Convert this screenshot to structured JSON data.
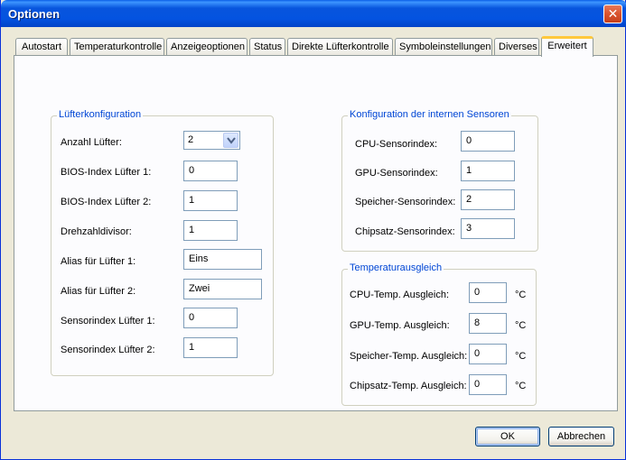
{
  "window": {
    "title": "Optionen"
  },
  "tabs": [
    {
      "label": "Autostart"
    },
    {
      "label": "Temperaturkontrolle"
    },
    {
      "label": "Anzeigeoptionen"
    },
    {
      "label": "Status"
    },
    {
      "label": "Direkte Lüfterkontrolle"
    },
    {
      "label": "Symboleinstellungen"
    },
    {
      "label": "Diverses"
    },
    {
      "label": "Erweitert"
    }
  ],
  "active_tab": "Erweitert",
  "fan_config": {
    "title": "Lüfterkonfiguration",
    "fan_count_label": "Anzahl Lüfter:",
    "fan_count_value": "2",
    "bios_index_1_label": "BIOS-Index Lüfter 1:",
    "bios_index_1_value": "0",
    "bios_index_2_label": "BIOS-Index Lüfter 2:",
    "bios_index_2_value": "1",
    "divisor_label": "Drehzahldivisor:",
    "divisor_value": "1",
    "alias_1_label": "Alias für Lüfter 1:",
    "alias_1_value": "Eins",
    "alias_2_label": "Alias für Lüfter 2:",
    "alias_2_value": "Zwei",
    "sensor_index_1_label": "Sensorindex Lüfter 1:",
    "sensor_index_1_value": "0",
    "sensor_index_2_label": "Sensorindex Lüfter 2:",
    "sensor_index_2_value": "1"
  },
  "sensor_config": {
    "title": "Konfiguration der internen Sensoren",
    "cpu_label": "CPU-Sensorindex:",
    "cpu_value": "0",
    "gpu_label": "GPU-Sensorindex:",
    "gpu_value": "1",
    "memory_label": "Speicher-Sensorindex:",
    "memory_value": "2",
    "chipset_label": "Chipsatz-Sensorindex:",
    "chipset_value": "3"
  },
  "temp_offset": {
    "title": "Temperaturausgleich",
    "unit": "°C",
    "cpu_label": "CPU-Temp. Ausgleich:",
    "cpu_value": "0",
    "gpu_label": "GPU-Temp. Ausgleich:",
    "gpu_value": "8",
    "memory_label": "Speicher-Temp. Ausgleich:",
    "memory_value": "0",
    "chipset_label": "Chipsatz-Temp. Ausgleich:",
    "chipset_value": "0"
  },
  "buttons": {
    "ok": "OK",
    "cancel": "Abbrechen"
  },
  "colors": {
    "titlebar": "#0453e0",
    "group_title": "#0046d5",
    "active_tab_highlight": "#ffc83c"
  }
}
